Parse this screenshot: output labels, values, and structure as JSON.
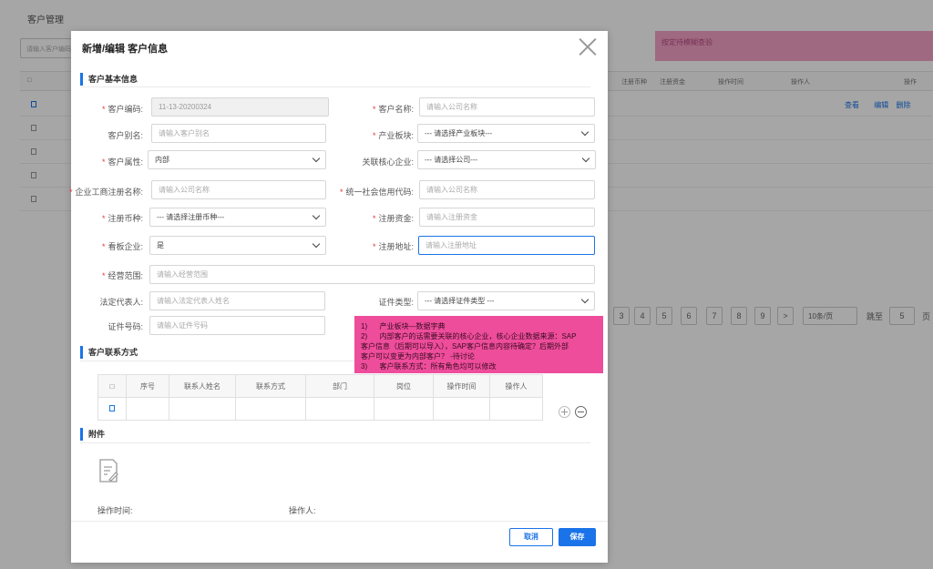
{
  "background": {
    "page_title": "客户管理",
    "search_placeholder": "请输入客户编码",
    "note": "按定待模糊查验",
    "table_headers": [
      "注册币种",
      "注册资金",
      "操作时间",
      "操作人",
      "操作"
    ],
    "row_actions": [
      "查看",
      "编辑",
      "删除"
    ],
    "pager": {
      "pages": [
        "3",
        "4",
        "5",
        "6",
        "7",
        "8",
        "9"
      ],
      "next": ">",
      "page_size": "10条/页",
      "jump_label": "跳至",
      "jump_value": "5",
      "page_suffix": "页"
    }
  },
  "modal": {
    "title": "新增/编辑 客户信息",
    "sections": {
      "basic": "客户基本信息",
      "contact": "客户联系方式",
      "attachment": "附件"
    },
    "fields": {
      "customer_code": {
        "label": "客户编码:",
        "value": "11-13-20200324",
        "required": true
      },
      "customer_name": {
        "label": "客户名称:",
        "placeholder": "请输入公司名称",
        "required": true
      },
      "customer_alias": {
        "label": "客户别名:",
        "placeholder": "请输入客户别名",
        "required": false
      },
      "industry": {
        "label": "产业板块:",
        "value": "--- 请选择产业板块---",
        "required": true
      },
      "customer_attr": {
        "label": "客户属性:",
        "value": "内部",
        "required": true
      },
      "core_company": {
        "label": "关联核心企业:",
        "value": "--- 请选择公司---",
        "required": false
      },
      "reg_name": {
        "label": "企业工商注册名称:",
        "placeholder": "请输入公司名称",
        "required": true
      },
      "credit_code": {
        "label": "统一社会信用代码:",
        "placeholder": "请输入公司名称",
        "required": true
      },
      "currency": {
        "label": "注册币种:",
        "value": "--- 请选择注册币种---",
        "required": true
      },
      "capital": {
        "label": "注册资金:",
        "placeholder": "请输入注册资金",
        "required": true
      },
      "board": {
        "label": "看板企业:",
        "value": "是",
        "required": true
      },
      "address": {
        "label": "注册地址:",
        "placeholder": "请输入注册地址",
        "required": true
      },
      "scope": {
        "label": "经营范围:",
        "placeholder": "请输入经营范围",
        "required": true
      },
      "legal_rep": {
        "label": "法定代表人:",
        "placeholder": "请输入法定代表人姓名",
        "required": false
      },
      "id_type": {
        "label": "证件类型:",
        "value": "--- 请选择证件类型 ---",
        "required": false
      },
      "id_number": {
        "label": "证件号码:",
        "placeholder": "请输入证件号码",
        "required": false
      }
    },
    "contact_table": {
      "headers": [
        "序号",
        "联系人姓名",
        "联系方式",
        "部门",
        "岗位",
        "操作时间",
        "操作人"
      ]
    },
    "footer": {
      "op_time_label": "操作时间:",
      "operator_label": "操作人:",
      "cancel": "取消",
      "save": "保存"
    }
  },
  "annotation": {
    "lines": [
      "1)      产业板块—数据字典",
      "2)      内部客户的话需要关联的核心企业，核心企业数据来源：SAP",
      "客户信息（后期可以导入），SAP客户信息内容待确定？后期外部",
      "客户可以变更为内部客户？ -待讨论",
      "3)      客户联系方式：所有角色均可以修改"
    ]
  }
}
